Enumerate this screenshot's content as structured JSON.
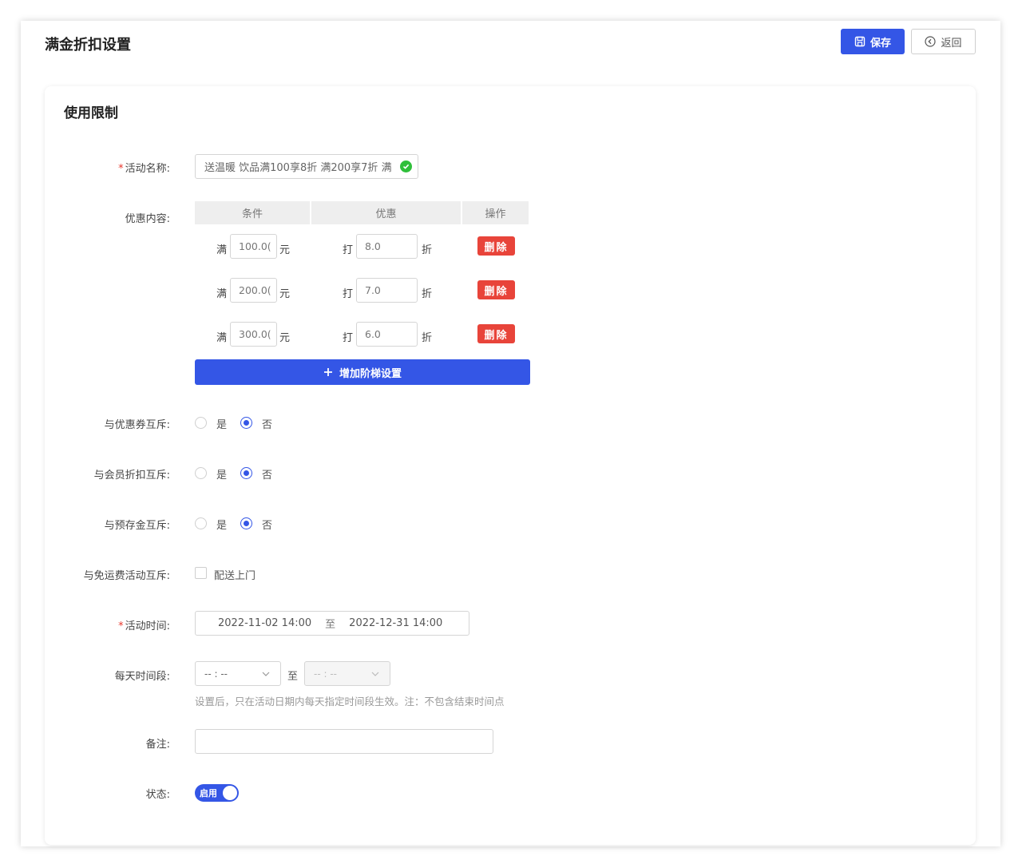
{
  "header": {
    "title": "满金折扣设置",
    "save_label": "保存",
    "back_label": "返回"
  },
  "section": {
    "title": "使用限制"
  },
  "form": {
    "activity_name": {
      "label": "活动名称:",
      "value": "送温暖 饮品满100享8折 满200享7折 满"
    },
    "discount": {
      "label": "优惠内容:",
      "headers": [
        "条件",
        "优惠",
        "操作"
      ],
      "rows": [
        {
          "prefix": "满",
          "amount": "100.0(",
          "unit": "元",
          "dprefix": "打",
          "discount": "8.0",
          "dunit": "折",
          "delete": "删除"
        },
        {
          "prefix": "满",
          "amount": "200.0(",
          "unit": "元",
          "dprefix": "打",
          "discount": "7.0",
          "dunit": "折",
          "delete": "删除"
        },
        {
          "prefix": "满",
          "amount": "300.0(",
          "unit": "元",
          "dprefix": "打",
          "discount": "6.0",
          "dunit": "折",
          "delete": "删除"
        }
      ],
      "add_label": "增加阶梯设置"
    },
    "coupon_exclusive": {
      "label": "与优惠券互斥:",
      "yes": "是",
      "no": "否",
      "selected": "否"
    },
    "member_exclusive": {
      "label": "与会员折扣互斥:",
      "yes": "是",
      "no": "否",
      "selected": "否"
    },
    "deposit_exclusive": {
      "label": "与预存金互斥:",
      "yes": "是",
      "no": "否",
      "selected": "否"
    },
    "free_shipping_exclusive": {
      "label": "与免运费活动互斥:",
      "option": "配送上门",
      "checked": false
    },
    "activity_time": {
      "label": "活动时间:",
      "start": "2022-11-02 14:00",
      "separator": "至",
      "end": "2022-12-31 14:00"
    },
    "daily_period": {
      "label": "每天时间段:",
      "start_placeholder": "-- : --",
      "separator": "至",
      "end_placeholder": "-- : --",
      "hint": "设置后，只在活动日期内每天指定时间段生效。注：不包含结束时间点"
    },
    "remark": {
      "label": "备注:",
      "value": ""
    },
    "status": {
      "label": "状态:",
      "switch_text": "启用",
      "on": true
    }
  },
  "colors": {
    "primary": "#3456e6",
    "danger": "#e8443a",
    "success": "#2fbf3a"
  }
}
